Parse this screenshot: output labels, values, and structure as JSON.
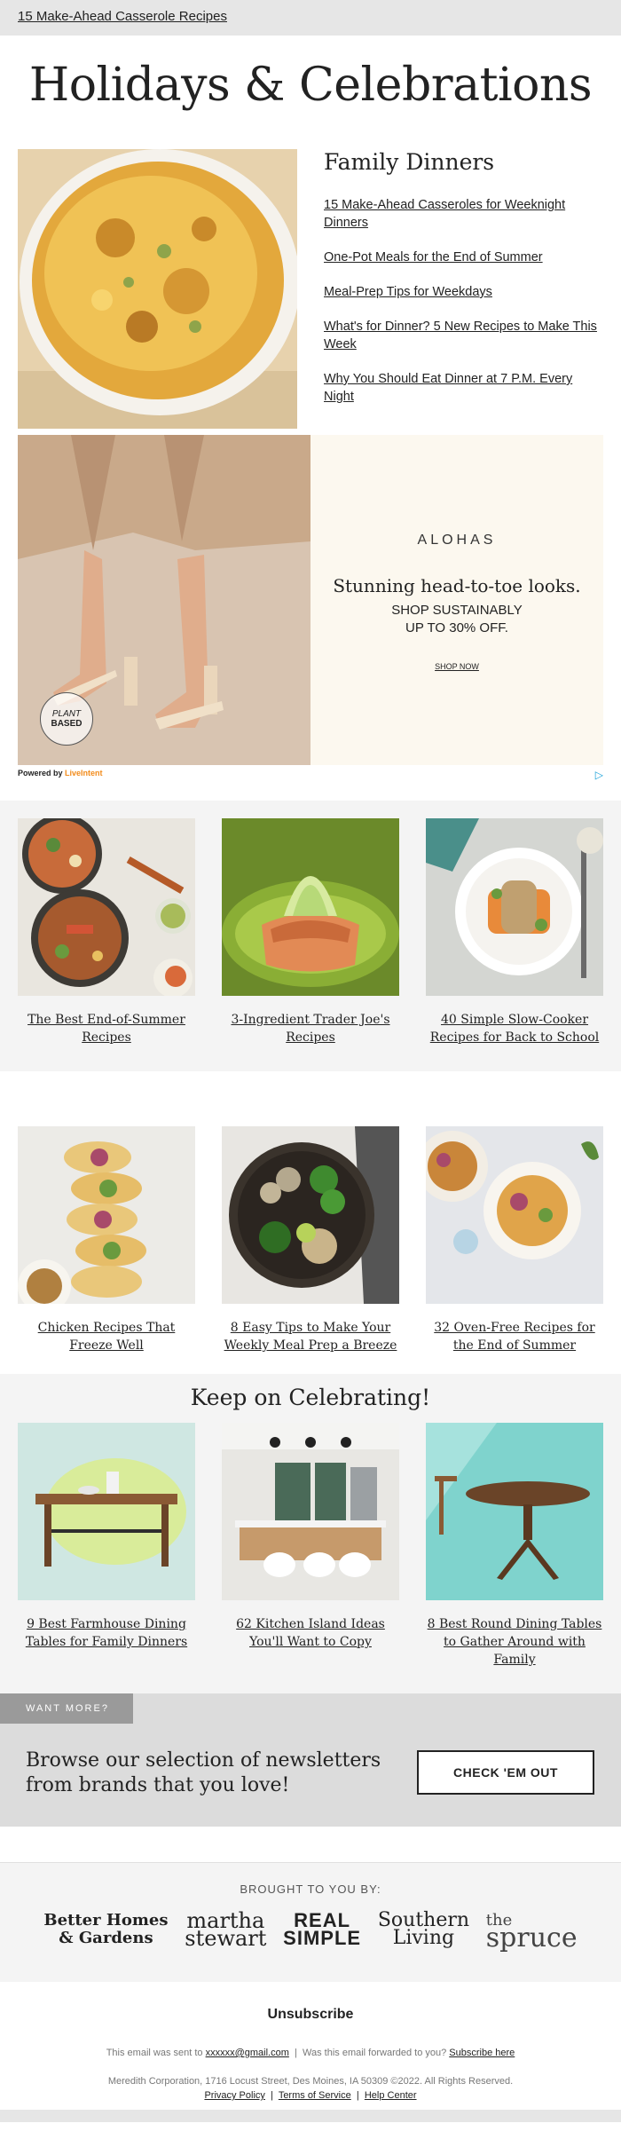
{
  "top": {
    "link": "15 Make-Ahead Casserole Recipes"
  },
  "hero": {
    "title": "Holidays & Celebrations"
  },
  "family": {
    "heading": "Family Dinners",
    "links": [
      "15 Make-Ahead Casseroles for Weeknight Dinners",
      "One-Pot Meals for the End of Summer",
      "Meal-Prep Tips for Weekdays",
      "What's for Dinner? 5 New Recipes to Make This Week",
      "Why You Should Eat Dinner at 7 P.M. Every Night"
    ]
  },
  "ad": {
    "brand": "ALOHAS",
    "headline": "Stunning head-to-toe looks.",
    "sub1": "SHOP SUSTAINABLY",
    "sub2": "UP TO 30% OFF.",
    "cta": "SHOP NOW",
    "badge1": "PLANT",
    "badge2": "BASED",
    "powered": "Powered by",
    "powered_brand": "LiveIntent"
  },
  "row1": [
    "The Best End-of-Summer Recipes",
    "3-Ingredient Trader Joe's Recipes",
    "40 Simple Slow-Cooker Recipes for Back to School"
  ],
  "row2": [
    "Chicken Recipes That Freeze Well",
    "8 Easy Tips to Make Your Weekly Meal Prep a Breeze",
    "32 Oven-Free Recipes for the End of Summer"
  ],
  "celebrate": {
    "heading": "Keep on Celebrating!",
    "items": [
      "9 Best Farmhouse Dining Tables for Family Dinners",
      "62 Kitchen Island Ideas You'll Want to Copy",
      "8 Best Round Dining Tables to Gather Around with Family"
    ]
  },
  "more": {
    "tag": "WANT MORE?",
    "text": "Browse our selection of newsletters from brands that you love!",
    "button": "CHECK 'EM OUT"
  },
  "brands": {
    "label": "BROUGHT TO YOU BY:",
    "bhg1": "Better Homes",
    "bhg2": "& Gardens",
    "martha1": "martha",
    "martha2": "stewart",
    "real1": "REAL",
    "real2": "SIMPLE",
    "south1": "Southern",
    "south2": "Living",
    "spruce1": "the",
    "spruce2": "spruce"
  },
  "footer": {
    "unsubscribe": "Unsubscribe",
    "sent_prefix": "This email was sent to",
    "email": "xxxxxx@gmail.com",
    "forwarded": "Was this email forwarded to you?",
    "subscribe": "Subscribe here",
    "address": "Meredith Corporation, 1716 Locust Street, Des Moines, IA 50309 ©2022. All Rights Reserved.",
    "privacy": "Privacy Policy",
    "terms": "Terms of Service",
    "help": "Help Center"
  },
  "colors": {
    "accent_orange": "#f28c1c",
    "ad_bg": "#fcf8ef",
    "gray_bg": "#f4f4f4"
  }
}
